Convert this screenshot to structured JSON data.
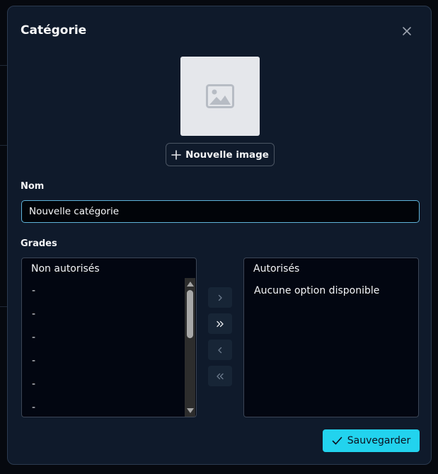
{
  "modal": {
    "title": "Catégorie",
    "close_icon": "close-icon"
  },
  "image": {
    "placeholder_icon": "image-placeholder-icon",
    "new_image_label": "Nouvelle image"
  },
  "name_field": {
    "label": "Nom",
    "value": "Nouvelle catégorie"
  },
  "grades": {
    "label": "Grades",
    "unauthorized": {
      "header": "Non autorisés",
      "items": [
        "-",
        "-",
        "-",
        "-",
        "-",
        "-"
      ]
    },
    "authorized": {
      "header": "Autorisés",
      "empty_text": "Aucune option disponible"
    },
    "controls": [
      "move-right",
      "move-all-right",
      "move-left",
      "move-all-left"
    ]
  },
  "footer": {
    "save_label": "Sauvegarder"
  },
  "colors": {
    "accent": "#22d3ee",
    "modal_bg": "#0f1a2b",
    "input_border": "#5fb3d9"
  }
}
